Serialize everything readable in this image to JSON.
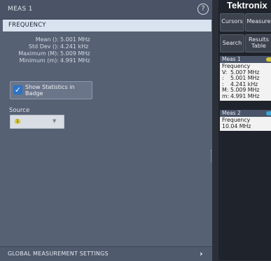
{
  "panel": {
    "title": "MEAS 1",
    "help_symbol": "?",
    "section_title": "FREQUENCY",
    "stats": [
      {
        "label": "Mean (): ",
        "value": "5.001 MHz"
      },
      {
        "label": "Std Dev (): ",
        "value": "4.241 kHz"
      },
      {
        "label": "Maximum (M): ",
        "value": "5.009 MHz"
      },
      {
        "label": "Minimum (m): ",
        "value": "4.991 MHz"
      }
    ],
    "checkbox_label": "Show Statistics in Badge",
    "checkbox_checked": true,
    "checkbox_mark": "✓",
    "source_label": "Source",
    "source_value": "1",
    "source_arrow": "▼",
    "global_settings_label": "GLOBAL MEASUREMENT SETTINGS",
    "global_settings_chevron": "›"
  },
  "right": {
    "logo": "Tektronix",
    "buttons": {
      "cursors": "Cursors",
      "measure": "Measure",
      "search": "Search",
      "results_line1": "Results",
      "results_line2": "Table"
    },
    "badges": [
      {
        "title": "Meas 1",
        "dot_color": "#d6c63a",
        "measurement": "Frequency",
        "rows": [
          {
            "k": "V:",
            "v": "5.007 MHz"
          },
          {
            "k": ":",
            "v": "5.001 MHz"
          },
          {
            "k": ":",
            "v": "4.241 kHz"
          },
          {
            "k": "M:",
            "v": "5.009 MHz"
          },
          {
            "k": "m:",
            "v": "4.991 MHz"
          }
        ]
      },
      {
        "title": "Meas 2",
        "dot_color": "#3aa7d6",
        "measurement": "Frequency",
        "value": "10.04 MHz"
      }
    ]
  },
  "colors": {
    "panel_bg": "#566174",
    "section_bar": "#d9e3f0",
    "checkbox_blue": "#2b74c8",
    "channel1_yellow": "#d6c63a",
    "channel2_cyan": "#3aa7d6"
  }
}
